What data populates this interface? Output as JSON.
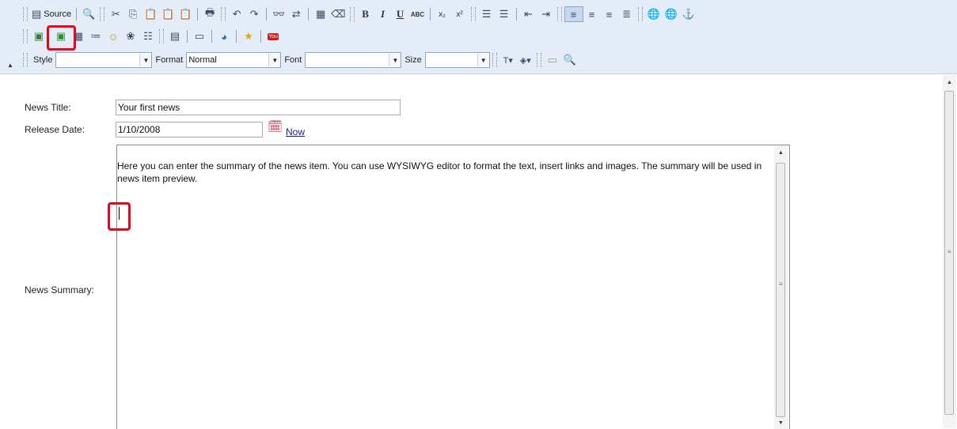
{
  "toolbar": {
    "source_label": "Source",
    "style_label": "Style",
    "style_value": "",
    "format_label": "Format",
    "format_value": "Normal",
    "font_label": "Font",
    "font_value": "",
    "size_label": "Size",
    "size_value": "",
    "bold": "B",
    "italic": "I",
    "underline": "U",
    "strike": "ABC",
    "subscript": "x₂",
    "superscript": "x²",
    "youtube": "You"
  },
  "form": {
    "news_title_label": "News Title:",
    "news_title_value": "Your first news",
    "release_date_label": "Release Date:",
    "release_date_value": "1/10/2008",
    "now_link": "Now",
    "news_summary_label": "News Summary:",
    "summary_text": "Here you can enter the summary of the news item. You can use WYSIWYG editor to format the text, insert links and images. The summary will be used in news item preview."
  },
  "colors": {
    "toolbar_bg": "#e4ecf7",
    "highlight": "#e3081b"
  }
}
